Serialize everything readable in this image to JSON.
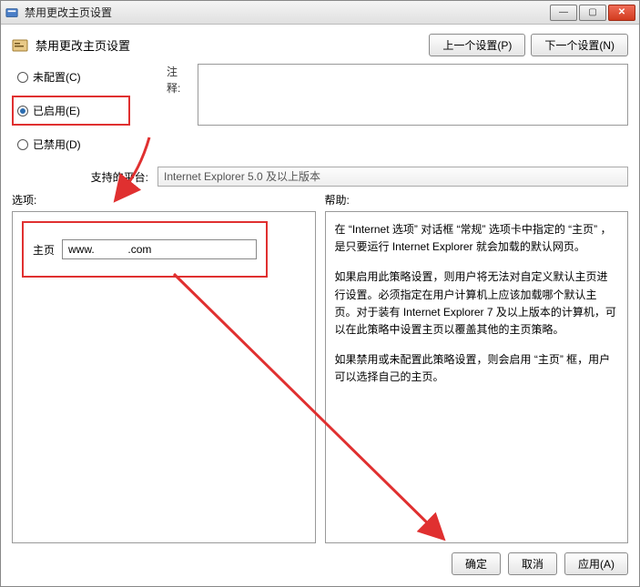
{
  "window": {
    "title": "禁用更改主页设置"
  },
  "header": {
    "title": "禁用更改主页设置"
  },
  "nav": {
    "prev": "上一个设置(P)",
    "next": "下一个设置(N)"
  },
  "radio": {
    "not_configured": "未配置(C)",
    "enabled": "已启用(E)",
    "disabled": "已禁用(D)"
  },
  "labels": {
    "notes": "注释:",
    "platform": "支持的平台:",
    "options": "选项:",
    "help": "帮助:",
    "homepage": "主页"
  },
  "platform": {
    "value": "Internet Explorer 5.0 及以上版本"
  },
  "options": {
    "homepage_value": "www.           .com"
  },
  "help": {
    "p1": "在 “Internet 选项” 对话框 “常规” 选项卡中指定的 “主页” ，是只要运行 Internet Explorer 就会加载的默认网页。",
    "p2": "如果启用此策略设置，则用户将无法对自定义默认主页进行设置。必须指定在用户计算机上应该加载哪个默认主页。对于装有 Internet Explorer 7 及以上版本的计算机，可以在此策略中设置主页以覆盖其他的主页策略。",
    "p3": "如果禁用或未配置此策略设置，则会启用 “主页” 框，用户可以选择自己的主页。"
  },
  "footer": {
    "ok": "确定",
    "cancel": "取消",
    "apply": "应用(A)"
  }
}
